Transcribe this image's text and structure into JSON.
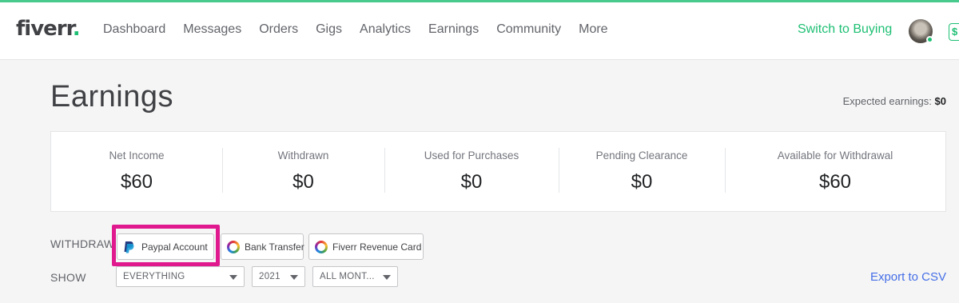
{
  "brand": {
    "name": "fiverr",
    "dot": ".",
    "accent": "#1dbf73",
    "highlight": "#e0198f",
    "link": "#446ee7"
  },
  "nav": {
    "items": [
      {
        "label": "Dashboard"
      },
      {
        "label": "Messages"
      },
      {
        "label": "Orders"
      },
      {
        "label": "Gigs"
      },
      {
        "label": "Analytics"
      },
      {
        "label": "Earnings"
      },
      {
        "label": "Community"
      },
      {
        "label": "More"
      }
    ],
    "switch_label": "Switch to Buying",
    "balance_icon": "$"
  },
  "page": {
    "title": "Earnings",
    "expected_label": "Expected earnings:",
    "expected_value": "$0"
  },
  "stats": [
    {
      "label": "Net Income",
      "value": "$60"
    },
    {
      "label": "Withdrawn",
      "value": "$0"
    },
    {
      "label": "Used for Purchases",
      "value": "$0"
    },
    {
      "label": "Pending Clearance",
      "value": "$0"
    },
    {
      "label": "Available for Withdrawal",
      "value": "$60"
    }
  ],
  "withdraw": {
    "label": "WITHDRAW",
    "options": [
      {
        "label": "Paypal Account",
        "icon": "paypal-icon"
      },
      {
        "label": "Bank Transfer",
        "icon": "ring-icon"
      },
      {
        "label": "Fiverr Revenue Card",
        "icon": "ring-icon"
      }
    ]
  },
  "show": {
    "label": "SHOW",
    "filters": [
      {
        "value": "EVERYTHING"
      },
      {
        "value": "2021"
      },
      {
        "value": "ALL MONT..."
      }
    ],
    "export_label": "Export to CSV"
  }
}
